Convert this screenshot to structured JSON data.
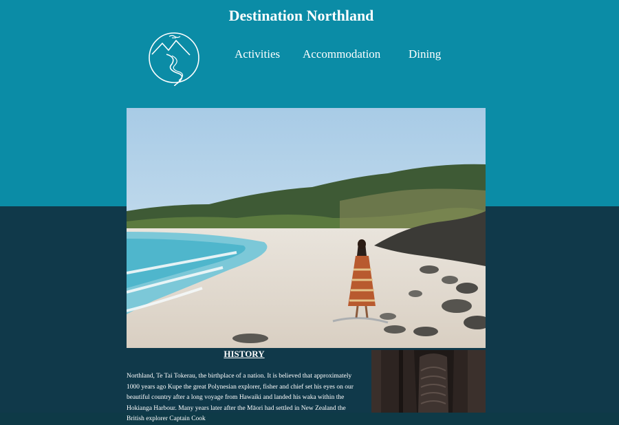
{
  "header": {
    "title": "Destination Northland",
    "nav": [
      "Activities",
      "Accommodation",
      "Dining"
    ]
  },
  "logo": {
    "icon": "mountain-river-logo-icon"
  },
  "hero": {
    "image": "beach-woman-walking-image"
  },
  "history": {
    "heading": "HISTORY",
    "text": "Northland, Te Tai Tokerau, the birthplace of a nation. It is believed that approximately 1000 years ago Kupe the great Polynesian explorer, fisher and chief set his eyes on our beautiful country after a long voyage from Hawaiki and landed his waka within the Hokianga Harbour. Many years later after the Māori had settled in New Zealand the British explorer Captain Cook"
  },
  "carving": {
    "image": "maori-carving-image"
  },
  "colors": {
    "top_band": "#0b8ca6",
    "bottom_band": "#10394a",
    "text": "#ffffff"
  }
}
